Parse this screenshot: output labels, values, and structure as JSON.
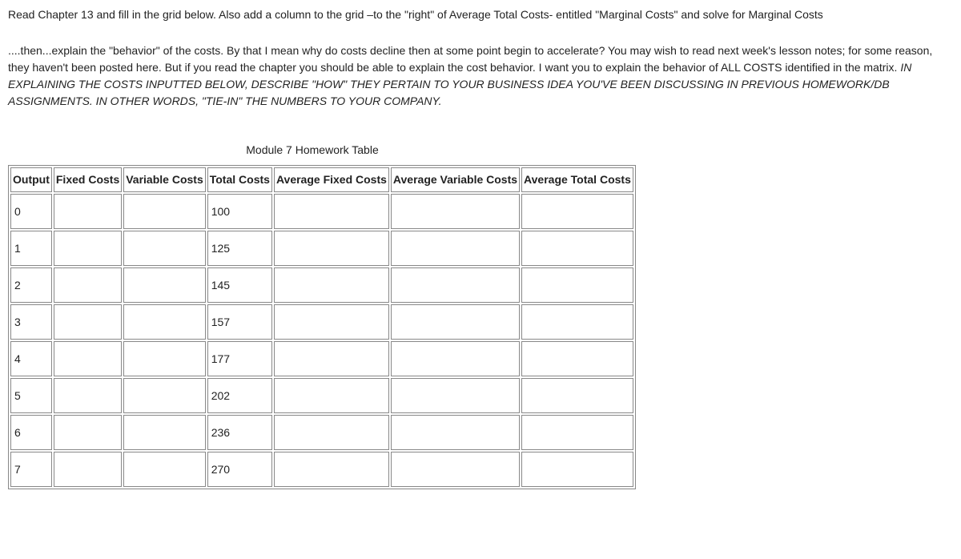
{
  "instructions": {
    "line1": "Read Chapter 13 and fill in the grid below. Also add a column to the grid –to the \"right\" of Average Total Costs- entitled \"Marginal Costs\" and solve for Marginal Costs",
    "para2_part1": "....then...explain the \"behavior\" of the costs. By that I mean why do costs decline then at some point begin to accelerate? You may wish to read next week's lesson notes; for some reason, they haven't been posted here. But if you read the chapter you should be able to explain the cost behavior. I want you to explain the behavior of ALL COSTS identified in the matrix. ",
    "para2_italic": "IN EXPLAINING THE COSTS INPUTTED BELOW, DESCRIBE \"HOW\" THEY PERTAIN TO YOUR BUSINESS IDEA YOU'VE BEEN DISCUSSING IN PREVIOUS HOMEWORK/DB ASSIGNMENTS. IN OTHER WORDS, \"TIE-IN\" THE NUMBERS TO YOUR COMPANY."
  },
  "table_title": "Module 7 Homework Table",
  "headers": {
    "output": "Output",
    "fixed_costs": "Fixed Costs",
    "variable_costs": "Variable Costs",
    "total_costs": "Total Costs",
    "avg_fixed_costs": "Average Fixed Costs",
    "avg_variable_costs": "Average Variable Costs",
    "avg_total_costs": "Average Total Costs"
  },
  "rows": [
    {
      "output": "0",
      "fixed_costs": "",
      "variable_costs": "",
      "total_costs": "100",
      "avg_fixed_costs": "",
      "avg_variable_costs": "",
      "avg_total_costs": ""
    },
    {
      "output": "1",
      "fixed_costs": "",
      "variable_costs": "",
      "total_costs": "125",
      "avg_fixed_costs": "",
      "avg_variable_costs": "",
      "avg_total_costs": ""
    },
    {
      "output": "2",
      "fixed_costs": "",
      "variable_costs": "",
      "total_costs": "145",
      "avg_fixed_costs": "",
      "avg_variable_costs": "",
      "avg_total_costs": ""
    },
    {
      "output": "3",
      "fixed_costs": "",
      "variable_costs": "",
      "total_costs": "157",
      "avg_fixed_costs": "",
      "avg_variable_costs": "",
      "avg_total_costs": ""
    },
    {
      "output": "4",
      "fixed_costs": "",
      "variable_costs": "",
      "total_costs": "177",
      "avg_fixed_costs": "",
      "avg_variable_costs": "",
      "avg_total_costs": ""
    },
    {
      "output": "5",
      "fixed_costs": "",
      "variable_costs": "",
      "total_costs": "202",
      "avg_fixed_costs": "",
      "avg_variable_costs": "",
      "avg_total_costs": ""
    },
    {
      "output": "6",
      "fixed_costs": "",
      "variable_costs": "",
      "total_costs": "236",
      "avg_fixed_costs": "",
      "avg_variable_costs": "",
      "avg_total_costs": ""
    },
    {
      "output": "7",
      "fixed_costs": "",
      "variable_costs": "",
      "total_costs": "270",
      "avg_fixed_costs": "",
      "avg_variable_costs": "",
      "avg_total_costs": ""
    }
  ]
}
